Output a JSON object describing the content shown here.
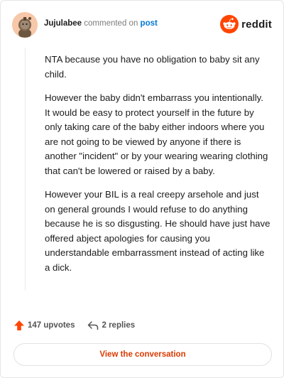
{
  "header": {
    "username": "Jujulabee",
    "action_text": "commented on",
    "post_link": "post",
    "brand": "reddit"
  },
  "comment": {
    "paragraphs": [
      "NTA because you have no obligation to baby sit any child.",
      "However the baby didn't embarrass you intentionally. It would be easy to protect yourself in the future by only taking care of the baby either indoors where you are not going to be viewed by anyone if there is another \"incident\" or by your wearing wearing clothing that can't be lowered or raised by a baby.",
      "However your BIL is a real creepy arsehole and just on general grounds I would refuse to do anything because he is so disgusting. He should have just have offered abject apologies for causing you understandable embarrassment instead of acting like a dick."
    ]
  },
  "footer": {
    "upvotes": "147 upvotes",
    "replies": "2 replies",
    "view_button": "View the conversation"
  },
  "icons": {
    "upvote": "upvote-arrow-icon",
    "reply": "reply-arrow-icon",
    "brand": "reddit-snoo-icon"
  },
  "colors": {
    "brand_orange": "#ff4500",
    "link_blue": "#0079d3",
    "button_text": "#d93a00"
  }
}
